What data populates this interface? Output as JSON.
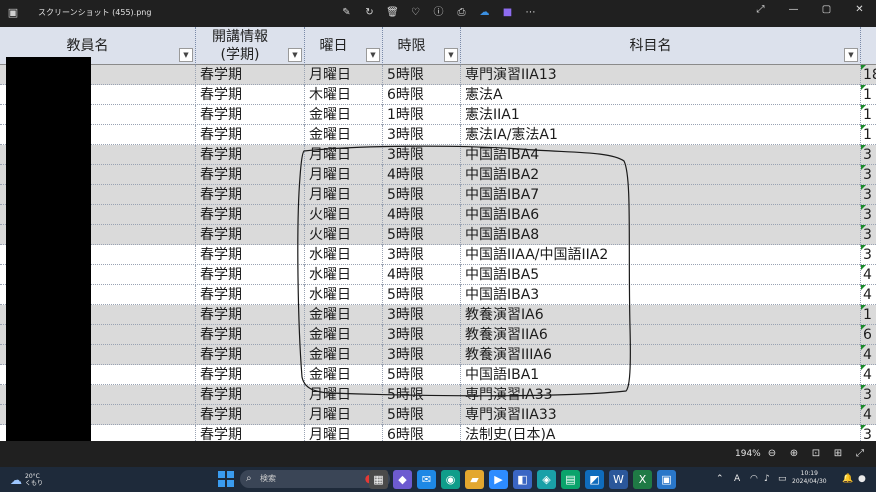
{
  "window": {
    "title": "スクリーンショット (455).png",
    "tools": [
      "edit-icon",
      "rotate-icon",
      "delete-icon",
      "heart-icon",
      "info-icon",
      "print-icon",
      "cloud-icon",
      "clipchamp-icon",
      "more-icon"
    ],
    "win_buttons": [
      "minimize-icon",
      "maximize-icon",
      "close-icon"
    ]
  },
  "sheet": {
    "headers": [
      "教員名",
      "開講情報\n(学期)",
      "曜日",
      "時限",
      "科目名"
    ],
    "rows": [
      {
        "term": "春学期",
        "day": "月曜日",
        "period": "5時限",
        "subject": "専門演習IIA13",
        "extra": "18",
        "gray": true
      },
      {
        "term": "春学期",
        "day": "木曜日",
        "period": "6時限",
        "subject": "憲法A",
        "extra": "1",
        "gray": false
      },
      {
        "term": "春学期",
        "day": "金曜日",
        "period": "1時限",
        "subject": "憲法IIA1",
        "extra": "1",
        "gray": false
      },
      {
        "term": "春学期",
        "day": "金曜日",
        "period": "3時限",
        "subject": "憲法IA/憲法A1",
        "extra": "1",
        "gray": false
      },
      {
        "term": "春学期",
        "day": "月曜日",
        "period": "3時限",
        "subject": "中国語IBA4",
        "extra": "3",
        "gray": true
      },
      {
        "term": "春学期",
        "day": "月曜日",
        "period": "4時限",
        "subject": "中国語IBA2",
        "extra": "3",
        "gray": true
      },
      {
        "term": "春学期",
        "day": "月曜日",
        "period": "5時限",
        "subject": "中国語IBA7",
        "extra": "3",
        "gray": true
      },
      {
        "term": "春学期",
        "day": "火曜日",
        "period": "4時限",
        "subject": "中国語IBA6",
        "extra": "3",
        "gray": true
      },
      {
        "term": "春学期",
        "day": "火曜日",
        "period": "5時限",
        "subject": "中国語IBA8",
        "extra": "3",
        "gray": true
      },
      {
        "term": "春学期",
        "day": "水曜日",
        "period": "3時限",
        "subject": "中国語IIAA/中国語IIA2",
        "extra": "3",
        "gray": false
      },
      {
        "term": "春学期",
        "day": "水曜日",
        "period": "4時限",
        "subject": "中国語IBA5",
        "extra": "4",
        "gray": false
      },
      {
        "term": "春学期",
        "day": "水曜日",
        "period": "5時限",
        "subject": "中国語IBA3",
        "extra": "4",
        "gray": false
      },
      {
        "term": "春学期",
        "day": "金曜日",
        "period": "3時限",
        "subject": "教養演習IA6",
        "extra": "1",
        "gray": true
      },
      {
        "term": "春学期",
        "day": "金曜日",
        "period": "3時限",
        "subject": "教養演習IIA6",
        "extra": "6",
        "gray": true
      },
      {
        "term": "春学期",
        "day": "金曜日",
        "period": "3時限",
        "subject": "教養演習IIIA6",
        "extra": "4",
        "gray": true
      },
      {
        "term": "春学期",
        "day": "金曜日",
        "period": "5時限",
        "subject": "中国語IBA1",
        "extra": "4",
        "gray": false
      },
      {
        "term": "春学期",
        "day": "月曜日",
        "period": "5時限",
        "subject": "専門演習IA33",
        "extra": "3",
        "gray": true
      },
      {
        "term": "春学期",
        "day": "月曜日",
        "period": "5時限",
        "subject": "専門演習IIA33",
        "extra": "4",
        "gray": true
      },
      {
        "term": "春学期",
        "day": "月曜日",
        "period": "6時限",
        "subject": "法制史(日本)A",
        "extra": "3",
        "gray": false
      }
    ]
  },
  "statusbar": {
    "zoom": "194%",
    "buttons": [
      "zoom-out-icon",
      "zoom-in-icon",
      "fit-window-icon",
      "actual-size-icon",
      "fullscreen-icon"
    ]
  },
  "taskbar": {
    "weather_temp": "20°C",
    "weather_text": "くもり",
    "search_placeholder": "検索",
    "apps": [
      {
        "name": "task-view-icon",
        "color": "#4a4a4a"
      },
      {
        "name": "copilot-icon",
        "color": "#6d5bd0"
      },
      {
        "name": "mail-icon",
        "color": "#1e88e5"
      },
      {
        "name": "edge-icon",
        "color": "#0f9d8a"
      },
      {
        "name": "file-explorer-icon",
        "color": "#e3a72f"
      },
      {
        "name": "zoom-icon",
        "color": "#2d8cff"
      },
      {
        "name": "photos-icon",
        "color": "#3a66c4"
      },
      {
        "name": "clipchamp-icon",
        "color": "#1aa0a8"
      },
      {
        "name": "notes-icon",
        "color": "#0aa36b"
      },
      {
        "name": "outlook-icon",
        "color": "#0f6cbd"
      },
      {
        "name": "word-icon",
        "color": "#2b579a"
      },
      {
        "name": "excel-icon",
        "color": "#1f7a45"
      },
      {
        "name": "photos-viewer-icon",
        "color": "#2a77c9"
      }
    ],
    "tray_ime": "A",
    "time": "10:19",
    "date": "2024/04/30"
  }
}
